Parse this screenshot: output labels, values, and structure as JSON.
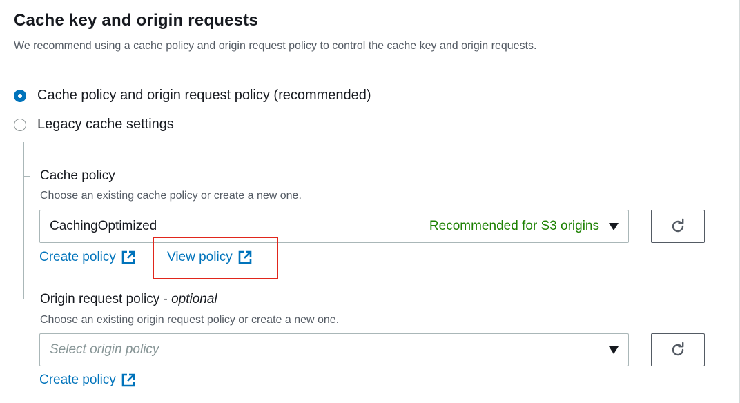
{
  "section": {
    "title": "Cache key and origin requests",
    "description": "We recommend using a cache policy and origin request policy to control the cache key and origin requests."
  },
  "options": [
    {
      "label": "Cache policy and origin request policy (recommended)",
      "selected": true
    },
    {
      "label": "Legacy cache settings",
      "selected": false
    }
  ],
  "cache_policy": {
    "label": "Cache policy",
    "description": "Choose an existing cache policy or create a new one.",
    "selected_value": "CachingOptimized",
    "tag": "Recommended for S3 origins",
    "create_link": "Create policy",
    "view_link": "View policy"
  },
  "origin_request_policy": {
    "label": "Origin request policy - ",
    "label_optional": "optional",
    "description": "Choose an existing origin request policy or create a new one.",
    "placeholder": "Select origin policy",
    "create_link": "Create policy"
  },
  "icons": {
    "external_link": "external-link-icon",
    "refresh": "refresh-icon",
    "dropdown": "caret-down-icon"
  },
  "colors": {
    "accent": "#0073bb",
    "recommended": "#1d8102",
    "highlight": "#e0261c"
  }
}
